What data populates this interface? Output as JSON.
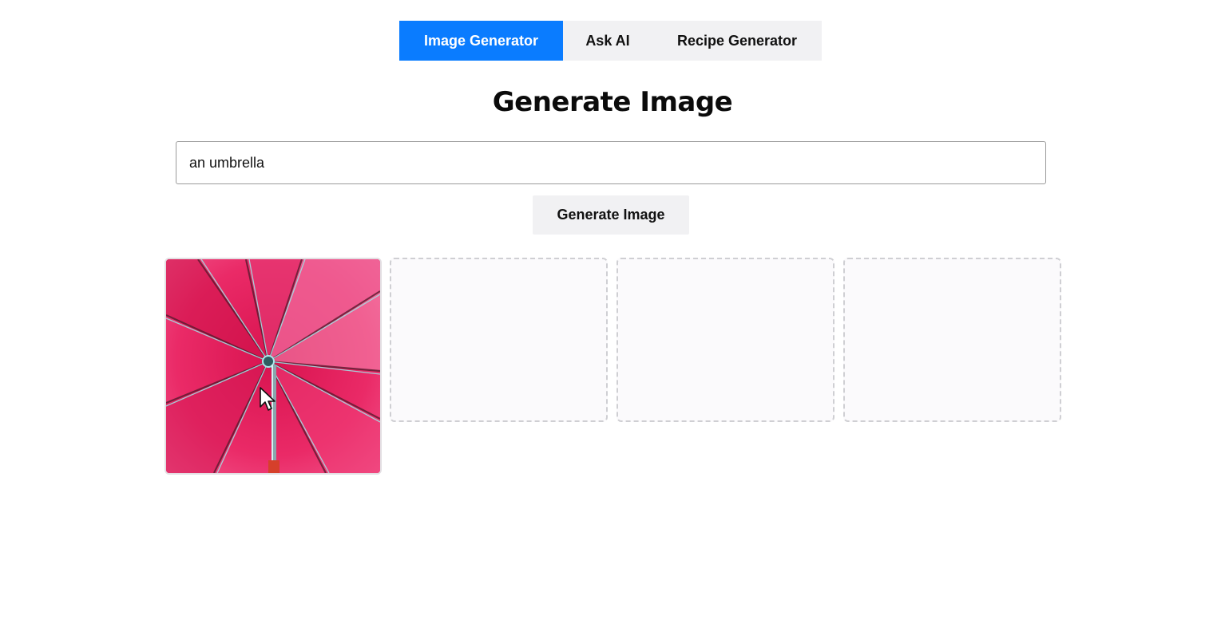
{
  "tabs": [
    {
      "label": "Image Generator",
      "active": true
    },
    {
      "label": "Ask AI",
      "active": false
    },
    {
      "label": "Recipe Generator",
      "active": false
    }
  ],
  "heading": "Generate Image",
  "prompt": {
    "value": "an umbrella",
    "placeholder": ""
  },
  "generate_button": "Generate Image",
  "images": [
    {
      "state": "generated",
      "subject": "pink umbrella underside",
      "icon": "umbrella-image"
    },
    {
      "state": "empty"
    },
    {
      "state": "empty"
    },
    {
      "state": "empty"
    }
  ],
  "colors": {
    "accent": "#0a7cff",
    "tab_bg": "#f1f1f3",
    "slot_border": "#cfcfd3",
    "umbrella_pink": "#e8235f"
  }
}
